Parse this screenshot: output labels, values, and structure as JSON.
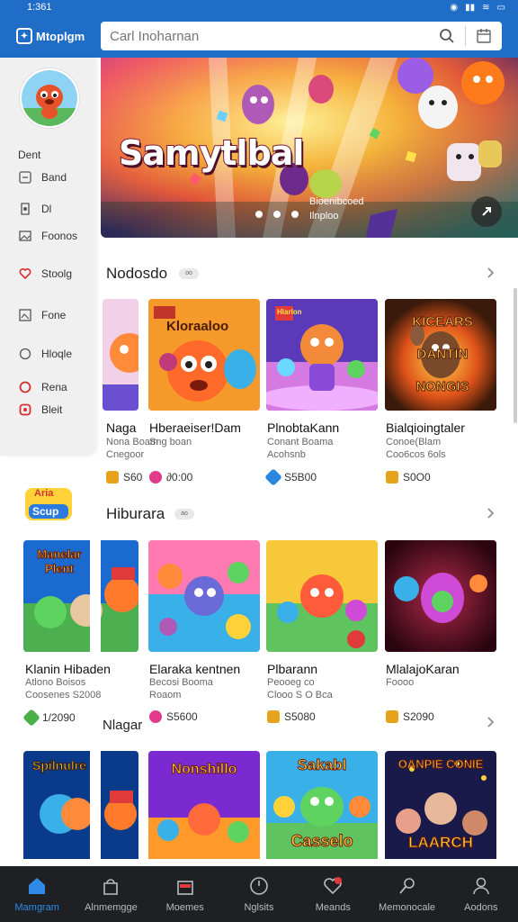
{
  "status": {
    "time": "1:361"
  },
  "header": {
    "app_name": "Mtoplgm",
    "search_placeholder": "Carl Inoharnan"
  },
  "sidebar": {
    "heading": "Dent",
    "items": [
      {
        "label": "Band",
        "icon": "gamepad-icon"
      },
      {
        "label": "Dl",
        "icon": "download-icon"
      },
      {
        "label": "Foonos",
        "icon": "image-icon"
      },
      {
        "label": "Stoolg",
        "icon": "heart-icon"
      },
      {
        "label": "Fone",
        "icon": "photo-icon"
      },
      {
        "label": "Hloqle",
        "icon": "chat-icon"
      },
      {
        "label": "Rena",
        "icon": "target-icon"
      },
      {
        "label": "Bleit",
        "icon": "badge-icon"
      }
    ]
  },
  "banner": {
    "title": "Samytlbal",
    "subtitle_line1": "Bioenibcoed",
    "subtitle_line2": "Ilnploo"
  },
  "sections": [
    {
      "title": "Nodosdo",
      "badge": "oo",
      "cards": [
        {
          "title": "Naga",
          "meta1": "Nona Boam",
          "meta2": "Cnegoor",
          "price": "S60",
          "coin_color": "#e6a21a"
        },
        {
          "title": "Hberaeiser!Dam",
          "meta1": "",
          "meta2": "Sng boan",
          "price": "∂0:00",
          "coin_color": "#e23a8a"
        },
        {
          "title": "PlnobtaKann",
          "meta1": "Conant Boama",
          "meta2": "Acohsnb",
          "price": "S5B00",
          "coin_color": "#2a88e0"
        },
        {
          "title": "Bialqioingtaler",
          "meta1": "Conoe(Blam",
          "meta2": "Coo6cos 6ols",
          "price": "S0O0",
          "coin_color": "#e6a21a"
        }
      ]
    },
    {
      "title": "Hiburara",
      "badge": "ao",
      "cards": [
        {
          "title": "Klanin Hibaden",
          "meta1": "Atlono Boisos",
          "meta2": "Coosenes S2008",
          "price": "1/2090",
          "coin_color": "#4cb04a"
        },
        {
          "title": "Elaraka kentnen",
          "meta1": "Becosi Booma",
          "meta2": "Roaom",
          "price": "S5600",
          "coin_color": "#e23a8a"
        },
        {
          "title": "Plbarann",
          "meta1": "Peooeg co",
          "meta2": "Clooo S O Bca",
          "price": "S5080",
          "coin_color": "#e6a21a"
        },
        {
          "title": "MlalajoKaran",
          "meta1": "",
          "meta2": "Foooo",
          "price": "S2090",
          "coin_color": "#e6a21a"
        }
      ]
    },
    {
      "title": "Nlagar",
      "cards": [
        {
          "title": "Spilnulre"
        },
        {
          "title": "Nonshillo"
        },
        {
          "title": "Sakabl Caselo"
        },
        {
          "title": "Oanpie Conie Laarch"
        }
      ]
    }
  ],
  "tiles": {
    "s1": [
      "Kloraaloo",
      "Hlarlon",
      "KICEARS DANTIN NONGIS"
    ],
    "s2": [
      "Manelar Plent"
    ],
    "s3": [
      "Spilnulre",
      "Nonshillo",
      "Sakabl",
      "Casselo",
      "OANPIE CONIE",
      "LAARCH"
    ],
    "edge_logo": [
      "Aria",
      "Scup"
    ]
  },
  "bottom_nav": [
    {
      "label": "Mamgram",
      "icon": "home-icon",
      "active": true
    },
    {
      "label": "Alnmemgge",
      "icon": "bag-icon"
    },
    {
      "label": "Moemes",
      "icon": "store-icon"
    },
    {
      "label": "Nglsits",
      "icon": "compass-icon"
    },
    {
      "label": "Meands",
      "icon": "heart-icon"
    },
    {
      "label": "Memonocale",
      "icon": "mic-icon"
    },
    {
      "label": "Aodons",
      "icon": "person-icon"
    }
  ],
  "colors": {
    "brand": "#1f6dc6",
    "accent": "#2f8ae6",
    "nav_bg": "#1e2024"
  }
}
